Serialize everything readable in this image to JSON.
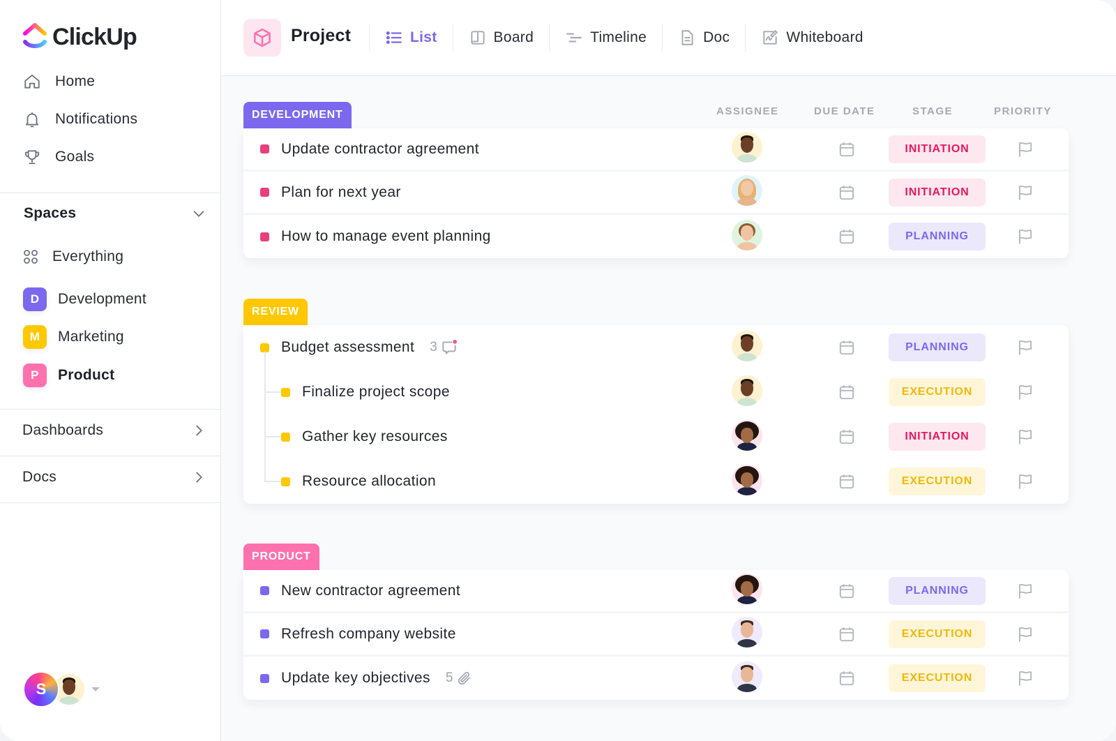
{
  "app": {
    "name": "ClickUp"
  },
  "colors": {
    "accent": "#7b68ee",
    "development": "#7b68ee",
    "review": "#ffc800",
    "product": "#fd71af",
    "dot_red": "#e8407a",
    "dot_yellow": "#ffc800",
    "dot_purple": "#7b68ee"
  },
  "sidebar": {
    "nav": [
      {
        "label": "Home",
        "icon": "home-icon"
      },
      {
        "label": "Notifications",
        "icon": "bell-icon"
      },
      {
        "label": "Goals",
        "icon": "trophy-icon"
      }
    ],
    "spaces": {
      "title": "Spaces",
      "everything_label": "Everything",
      "items": [
        {
          "initial": "D",
          "label": "Development",
          "color": "#7b68ee"
        },
        {
          "initial": "M",
          "label": "Marketing",
          "color": "#ffc800"
        },
        {
          "initial": "P",
          "label": "Product",
          "color": "#fd71af",
          "active": true
        }
      ]
    },
    "dashboards_label": "Dashboards",
    "docs_label": "Docs",
    "user": {
      "initial": "S"
    }
  },
  "header": {
    "title": "Project",
    "tabs": [
      {
        "label": "List",
        "icon": "list-icon",
        "active": true
      },
      {
        "label": "Board",
        "icon": "board-icon"
      },
      {
        "label": "Timeline",
        "icon": "timeline-icon"
      },
      {
        "label": "Doc",
        "icon": "doc-icon"
      },
      {
        "label": "Whiteboard",
        "icon": "whiteboard-icon"
      }
    ]
  },
  "columns": {
    "assignee": "ASSIGNEE",
    "due_date": "DUE DATE",
    "stage": "STAGE",
    "priority": "PRIORITY"
  },
  "stages": {
    "INITIATION": {
      "bg": "#fde8ef",
      "fg": "#e8175d"
    },
    "PLANNING": {
      "bg": "#ebe8fc",
      "fg": "#7b68ee"
    },
    "EXECUTION": {
      "bg": "#fff6d9",
      "fg": "#f2b807"
    }
  },
  "groups": [
    {
      "name": "DEVELOPMENT",
      "tasks": [
        {
          "name": "Update contractor agreement",
          "assignee": "man-beard",
          "stage": "INITIATION"
        },
        {
          "name": "Plan for next year",
          "assignee": "woman-blonde",
          "stage": "INITIATION"
        },
        {
          "name": "How to manage event planning",
          "assignee": "woman-brunette",
          "stage": "PLANNING"
        }
      ]
    },
    {
      "name": "REVIEW",
      "tasks": [
        {
          "name": "Budget assessment",
          "assignee": "man-beard",
          "stage": "PLANNING",
          "comments": "3"
        },
        {
          "name": "Finalize project scope",
          "assignee": "man-beard",
          "stage": "EXECUTION",
          "subtask": true
        },
        {
          "name": "Gather key resources",
          "assignee": "man-afro",
          "stage": "INITIATION",
          "subtask": true
        },
        {
          "name": "Resource allocation",
          "assignee": "man-afro",
          "stage": "EXECUTION",
          "subtask": true
        }
      ]
    },
    {
      "name": "PRODUCT",
      "tasks": [
        {
          "name": "New contractor agreement",
          "assignee": "man-afro",
          "stage": "PLANNING"
        },
        {
          "name": "Refresh company website",
          "assignee": "man-smiling",
          "stage": "EXECUTION"
        },
        {
          "name": "Update key objectives",
          "assignee": "man-smiling",
          "stage": "EXECUTION",
          "attachments": "5"
        }
      ]
    }
  ]
}
